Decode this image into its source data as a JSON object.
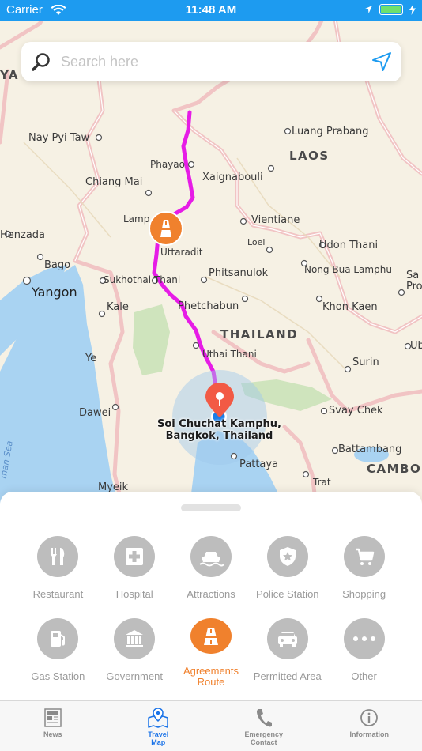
{
  "status_bar": {
    "carrier": "Carrier",
    "time": "11:48 AM",
    "wifi_icon": "wifi-icon",
    "location_icon": "location-arrow-icon",
    "battery_icon": "battery-icon",
    "charging_icon": "bolt-icon",
    "background_color": "#1d9bf0"
  },
  "search": {
    "placeholder": "Search here",
    "search_icon": "magnifier-icon",
    "navigate_icon": "navigation-arrow-icon",
    "navigate_color": "#1d9bf0"
  },
  "map": {
    "labels": {
      "burma": "YA\n(BURMA)",
      "nay_pyi_taw": "Nay Pyi Taw",
      "luang_prabang": "Luang Prabang",
      "laos": "LAOS",
      "phayao": "Phayao",
      "xaignabouli": "Xaignabouli",
      "chiang_mai": "Chiang Mai",
      "lamp": "Lamp",
      "vientiane": "Vientiane",
      "henzada": "Henzada",
      "loei": "Loei",
      "udon_thani": "Udon Thani",
      "uttaradit": "Uttaradit",
      "bago": "Bago",
      "phitsanulok": "Phitsanulok",
      "nong_bua_lamphu": "Nong Bua Lamphu",
      "sa": "Sa",
      "pro": "Pro",
      "yangon": "Yangon",
      "sukhothai_thani": "Sukhothai Thani",
      "kale": "Kale",
      "phetchabun": "Phetchabun",
      "khon_kaen": "Khon Kaen",
      "thailand": "THAILAND",
      "ye": "Ye",
      "uthai_thani": "Uthai Thani",
      "surin": "Surin",
      "ub": "Ub",
      "dawei": "Dawei",
      "svay_chek": "Svay Chek",
      "battambang": "Battambang",
      "pattaya": "Pattaya",
      "cambo": "CAMBO",
      "trat": "Trat",
      "myeik": "Myeik",
      "sea": "man Sea",
      "destination": "Soi Chuchat Kamphu,\nBangkok, Thailand"
    },
    "route_color": "#e61ce6",
    "route_marker_icon": "road-icon",
    "destination_pin_icon": "map-pin-icon",
    "user_location_icon": "user-location-dot-icon"
  },
  "categories": [
    {
      "label": "Restaurant",
      "icon": "fork-knife-icon",
      "active": false
    },
    {
      "label": "Hospital",
      "icon": "medical-cross-icon",
      "active": false
    },
    {
      "label": "Attractions",
      "icon": "boat-icon",
      "active": false
    },
    {
      "label": "Police Station",
      "icon": "police-badge-icon",
      "active": false
    },
    {
      "label": "Shopping",
      "icon": "shopping-cart-icon",
      "active": false
    },
    {
      "label": "Gas Station",
      "icon": "gas-pump-icon",
      "active": false
    },
    {
      "label": "Government",
      "icon": "government-building-icon",
      "active": false
    },
    {
      "label": "Agreements\nRoute",
      "icon": "road-icon",
      "active": true
    },
    {
      "label": "Permitted Area",
      "icon": "car-icon",
      "active": false
    },
    {
      "label": "Other",
      "icon": "more-dots-icon",
      "active": false
    }
  ],
  "category_colors": {
    "inactive": "#bdbdbd",
    "active": "#f0812d"
  },
  "tabs": [
    {
      "label": "News",
      "icon": "newspaper-icon",
      "active": false
    },
    {
      "label": "Travel\nMap",
      "icon": "travel-map-icon",
      "active": true
    },
    {
      "label": "Emergency\nContact",
      "icon": "phone-icon",
      "active": false
    },
    {
      "label": "Information",
      "icon": "info-icon",
      "active": false
    }
  ],
  "tab_active_color": "#1a73e8"
}
